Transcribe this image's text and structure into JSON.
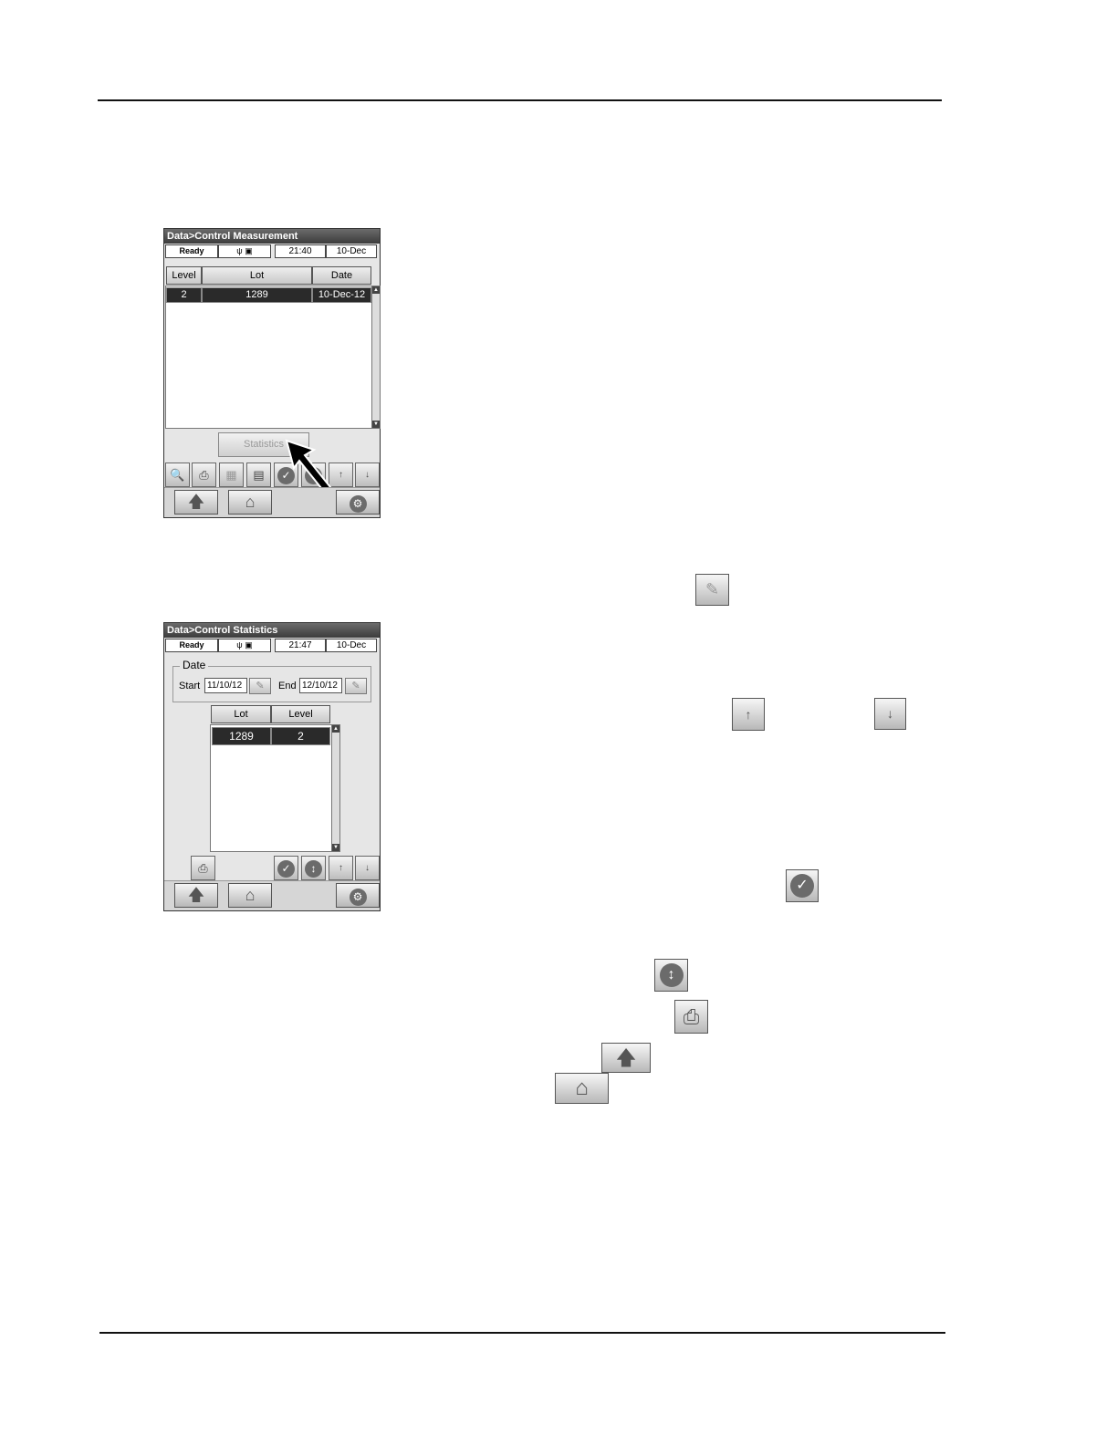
{
  "screen1": {
    "title": "Data>Control Measurement",
    "status": {
      "ready": "Ready",
      "time": "21:40",
      "date": "10-Dec"
    },
    "columns": [
      "Level",
      "Lot",
      "Date"
    ],
    "rows": [
      {
        "level": "2",
        "lot": "1289",
        "date": "10-Dec-12"
      }
    ],
    "statistics_button": "Statistics"
  },
  "screen2": {
    "title": "Data>Control Statistics",
    "status": {
      "ready": "Ready",
      "time": "21:47",
      "date": "10-Dec"
    },
    "date_group": "Date",
    "start_label": "Start",
    "start_value": "11/10/12",
    "end_label": "End",
    "end_value": "12/10/12",
    "columns": [
      "Lot",
      "Level"
    ],
    "rows": [
      {
        "lot": "1289",
        "level": "2"
      }
    ]
  },
  "icons": {
    "magnifier": "magnifier-icon",
    "printer": "printer-icon",
    "trash": "trash-icon",
    "export": "export-icon",
    "check": "check-icon",
    "updown": "up-down-icon",
    "page_up": "page-up-icon",
    "page_down": "page-down-icon",
    "back": "up-arrow-icon",
    "home": "home-icon",
    "tools": "wrench-icon",
    "pencil": "pencil-icon"
  }
}
